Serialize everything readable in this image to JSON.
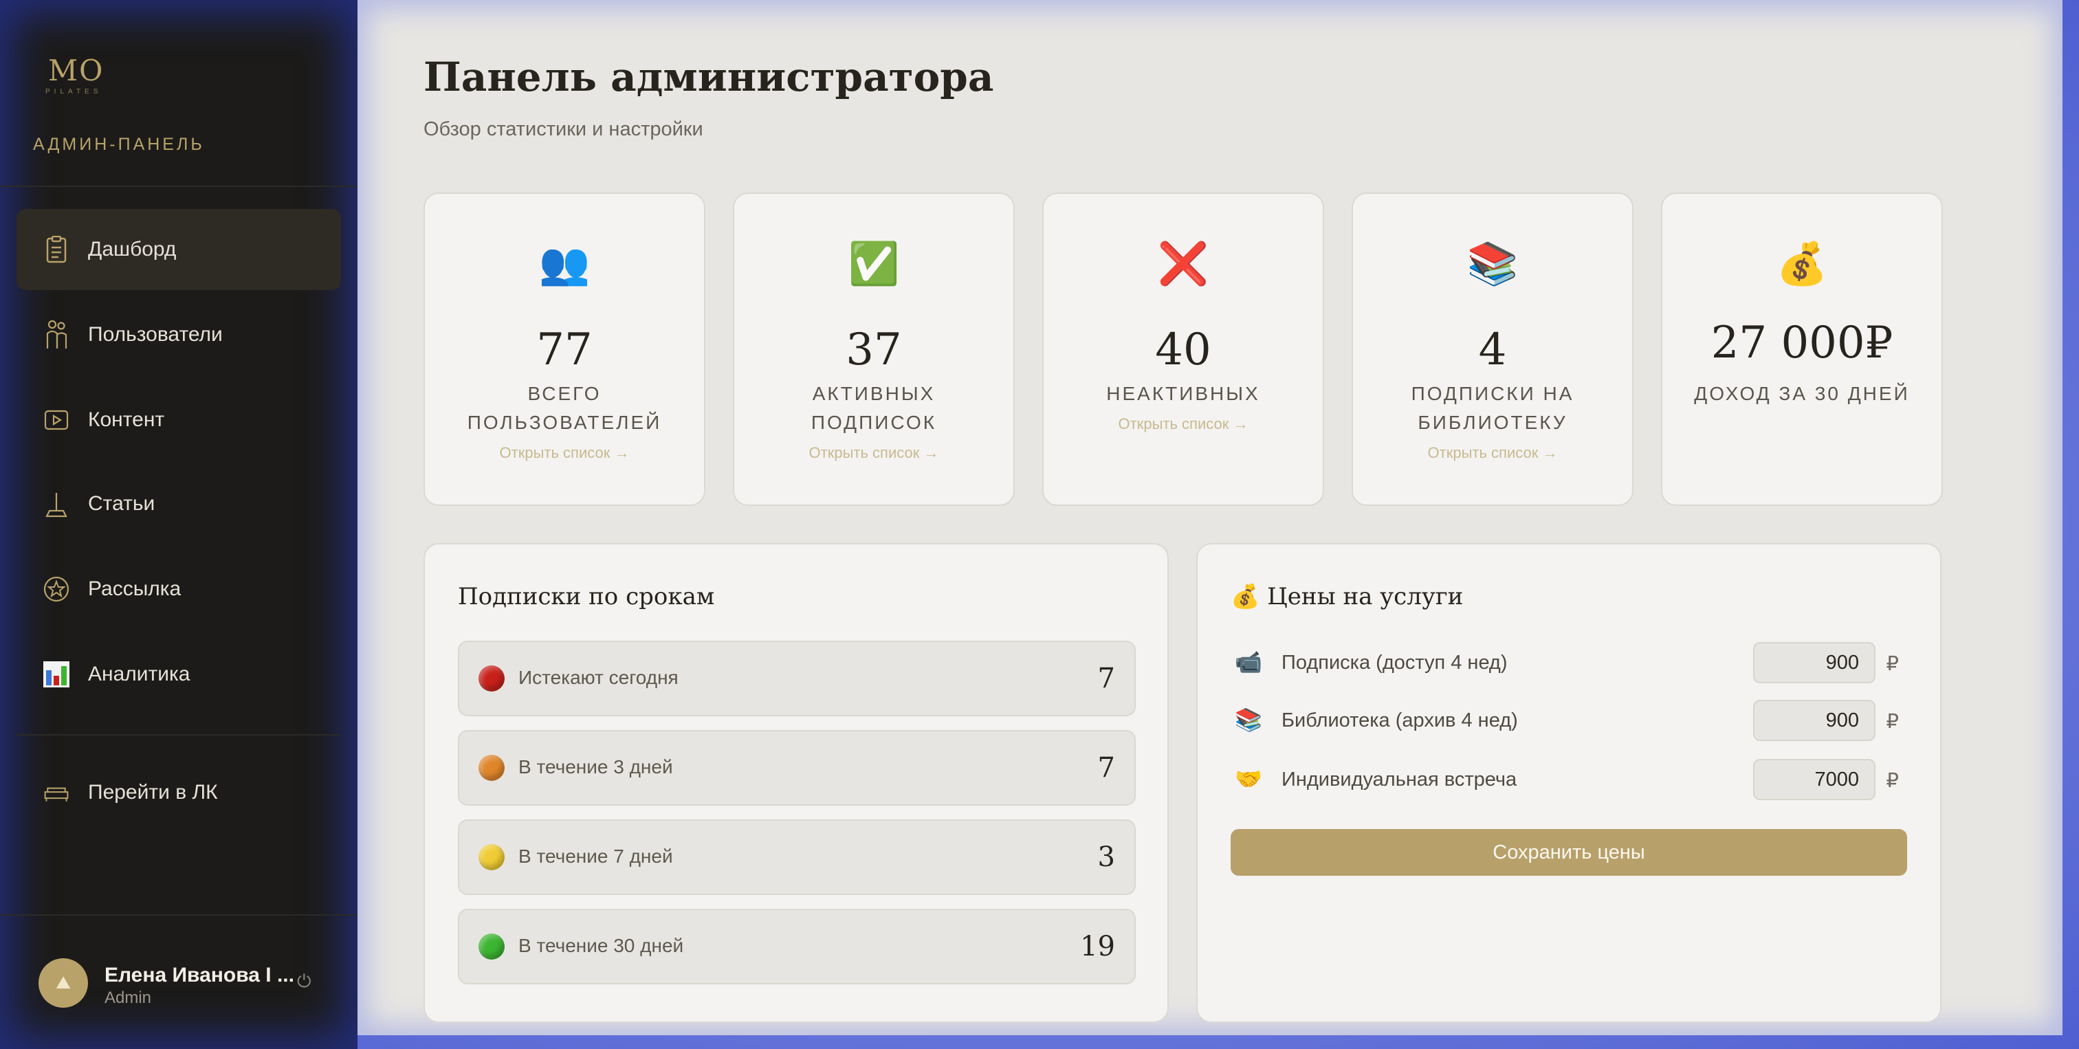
{
  "sidebar": {
    "logo_mark": "MO",
    "logo_sub": "PILATES",
    "caption": "АДМИН-ПАНЕЛЬ",
    "items": [
      {
        "label": "Дашборд",
        "icon": "clipboard-icon",
        "active": true
      },
      {
        "label": "Пользователи",
        "icon": "people-icon"
      },
      {
        "label": "Контент",
        "icon": "play-icon"
      },
      {
        "label": "Статьи",
        "icon": "pen-icon"
      },
      {
        "label": "Рассылка",
        "icon": "star-badge-icon"
      },
      {
        "label": "Аналитика",
        "icon": "bar-chart-icon"
      }
    ],
    "lk_link": "Перейти в ЛК",
    "user": {
      "name": "Елена Иванова I ...",
      "role": "Admin"
    }
  },
  "header": {
    "title": "Панель администратора",
    "subtitle": "Обзор статистики и настройки"
  },
  "stats": [
    {
      "icon": "👥",
      "value": "77",
      "label": "ВСЕГО ПОЛЬЗОВАТЕЛЕЙ",
      "link": "Открыть список →"
    },
    {
      "icon": "✅",
      "value": "37",
      "label": "АКТИВНЫХ ПОДПИСОК",
      "link": "Открыть список →"
    },
    {
      "icon": "❌",
      "value": "40",
      "label": "НЕАКТИВНЫХ",
      "link": "Открыть список →"
    },
    {
      "icon": "📚",
      "value": "4",
      "label": "ПОДПИСКИ НА БИБЛИОТЕКУ",
      "link": "Открыть список →"
    },
    {
      "icon": "💰",
      "value": "27 000₽",
      "label": "ДОХОД ЗА 30 ДНЕЙ"
    }
  ],
  "terms": {
    "title": "Подписки по срокам",
    "rows": [
      {
        "label": "Истекают сегодня",
        "count": "7",
        "color": "#c8211b"
      },
      {
        "label": "В течение 3 дней",
        "count": "7",
        "color": "#e0862a"
      },
      {
        "label": "В течение 7 дней",
        "count": "3",
        "color": "#f0cc34"
      },
      {
        "label": "В течение 30 дней",
        "count": "19",
        "color": "#3cb531"
      }
    ]
  },
  "prices": {
    "title": "💰 Цены на услуги",
    "rows": [
      {
        "icon": "📹",
        "label": "Подписка (доступ 4 нед)",
        "value": "900",
        "currency": "₽"
      },
      {
        "icon": "📚",
        "label": "Библиотека (архив 4 нед)",
        "value": "900",
        "currency": "₽"
      },
      {
        "icon": "🤝",
        "label": "Индивидуальная встреча",
        "value": "7000",
        "currency": "₽"
      }
    ],
    "save_label": "Сохранить цены"
  },
  "colors": {
    "accent": "#b8a06a",
    "sidebar_bg": "#1c1b19",
    "main_bg": "#e8e6e2"
  }
}
